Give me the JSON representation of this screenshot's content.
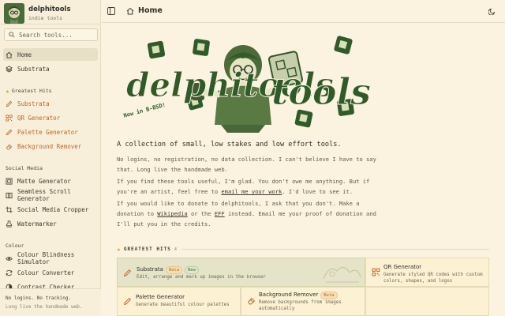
{
  "brand": {
    "name": "delphitools",
    "tagline": "indie tools"
  },
  "search": {
    "placeholder": "Search tools..."
  },
  "nav": {
    "top": [
      {
        "label": "Home",
        "icon": "home-icon",
        "active": true
      },
      {
        "label": "Substrata",
        "icon": "layers-icon"
      }
    ],
    "greatest_hits": {
      "heading": "Greatest Hits",
      "items": [
        {
          "label": "Substrata",
          "icon": "pencil-icon"
        },
        {
          "label": "QR Generator",
          "icon": "qr-icon"
        },
        {
          "label": "Palette Generator",
          "icon": "pencil-icon"
        },
        {
          "label": "Background Remover",
          "icon": "eraser-icon"
        }
      ]
    },
    "social_media": {
      "heading": "Social Media",
      "items": [
        {
          "label": "Matte Generator",
          "icon": "frame-icon"
        },
        {
          "label": "Seamless Scroll Generator",
          "icon": "columns-icon"
        },
        {
          "label": "Social Media Cropper",
          "icon": "crop-icon"
        },
        {
          "label": "Watermarker",
          "icon": "stamp-icon"
        }
      ]
    },
    "colour": {
      "heading": "Colour",
      "items": [
        {
          "label": "Colour Blindness Simulator",
          "icon": "eye-icon"
        },
        {
          "label": "Colour Converter",
          "icon": "refresh-icon"
        },
        {
          "label": "Contrast Checker",
          "icon": "contrast-icon"
        }
      ]
    }
  },
  "sidebar_footer": {
    "line1": "No logins. No tracking.",
    "line2": "Long live the handmade web."
  },
  "topbar": {
    "title": "Home"
  },
  "hero": {
    "logo_text": "delphitools",
    "sticker_text": "Now in B-BSD!"
  },
  "main": {
    "headline": "A collection of small, low stakes and low effort tools.",
    "p1": "No logins, no registration, no data collection. I can't believe I have to say that. Long live the handmade web.",
    "p2_a": "If you find these tools useful, I'm glad. You don't owe me anything. But if you're an artist, feel free to ",
    "p2_link": "email me your work",
    "p2_b": ". I'd love to see it.",
    "p3_a": "If you would like to donate to delphitools, I ask that you don't. Make a donation to ",
    "p3_link1": "Wikipedia",
    "p3_mid": " or the ",
    "p3_link2": "EFF",
    "p3_b": " instead. Email me your proof of donation and I'll put you in the credits."
  },
  "greatest_hits": {
    "title": "GREATEST HITS",
    "count": "4",
    "cards": [
      {
        "title": "Substrata",
        "badges": [
          "Beta",
          "New"
        ],
        "desc": "Edit, arrange and mark up images in the browser",
        "icon": "pencil-icon"
      },
      {
        "title": "QR Generator",
        "desc": "Generate styled QR codes with custom colors, shapes, and logos",
        "icon": "qr-icon"
      },
      {
        "title": "Palette Generator",
        "desc": "Generate beautiful colour palettes",
        "icon": "pencil-icon"
      },
      {
        "title": "Background Remover",
        "badges": [
          "Beta"
        ],
        "desc": "Remove backgrounds from images automatically",
        "icon": "eraser-icon"
      }
    ]
  },
  "colors": {
    "accent_green": "#4b6b3a",
    "accent_orange": "#c06428",
    "star": "#e2a024",
    "background": "#fbf3df"
  }
}
